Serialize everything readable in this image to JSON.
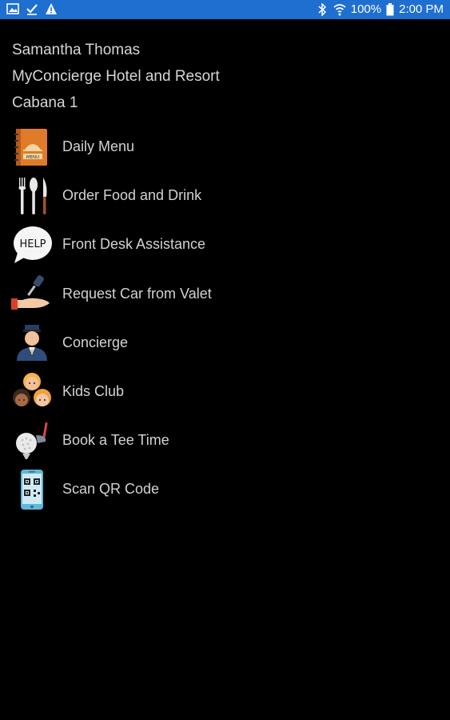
{
  "status_bar": {
    "battery": "100%",
    "time": "2:00 PM",
    "bg_color": "#1e6fd0",
    "left_icons": [
      "image-icon",
      "check-icon",
      "warning-icon"
    ],
    "right_icons": [
      "bluetooth-icon",
      "wifi-icon",
      "battery-icon"
    ]
  },
  "header": {
    "name": "Samantha Thomas",
    "hotel": "MyConcierge Hotel and Resort",
    "room": "Cabana 1"
  },
  "menu": {
    "items": [
      {
        "label": "Daily Menu",
        "icon": "menu-book-icon"
      },
      {
        "label": "Order Food and Drink",
        "icon": "utensils-icon"
      },
      {
        "label": "Front Desk Assistance",
        "icon": "help-bubble-icon"
      },
      {
        "label": "Request Car from Valet",
        "icon": "car-key-icon"
      },
      {
        "label": "Concierge",
        "icon": "concierge-person-icon"
      },
      {
        "label": "Kids Club",
        "icon": "kids-icon"
      },
      {
        "label": "Book a Tee Time",
        "icon": "golf-icon"
      },
      {
        "label": "Scan QR Code",
        "icon": "qr-phone-icon"
      }
    ]
  }
}
